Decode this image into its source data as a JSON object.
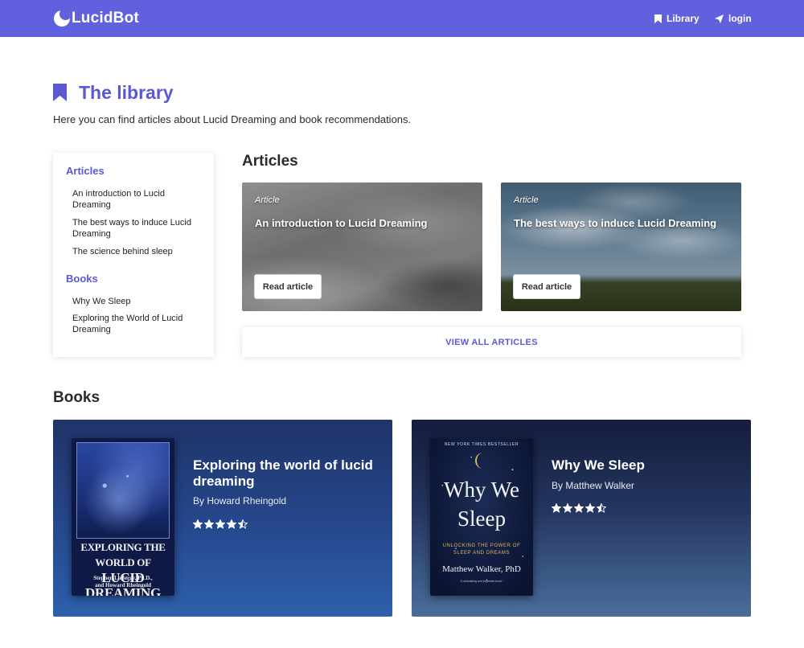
{
  "navbar": {
    "brand": "LucidBot",
    "library_label": "Library",
    "login_label": "login",
    "color": "#6160df"
  },
  "header": {
    "title": "The library",
    "description": "Here you can find articles about Lucid Dreaming and book recommendations."
  },
  "sidebar": {
    "articles_heading": "Articles",
    "articles": [
      "An introduction to Lucid Dreaming",
      "The best ways to induce Lucid Dreaming",
      "The science behind sleep"
    ],
    "books_heading": "Books",
    "books": [
      "Why We Sleep",
      "Exploring the World of Lucid Dreaming"
    ]
  },
  "articles": {
    "title": "Articles",
    "cards": [
      {
        "kicker": "Article",
        "title": "An introduction to Lucid Dreaming",
        "button": "Read article"
      },
      {
        "kicker": "Article",
        "title": "The best ways to induce Lucid Dreaming",
        "button": "Read article"
      }
    ],
    "view_all_label": "VIEW ALL ARTICLES"
  },
  "books": {
    "title": "Books",
    "cards": [
      {
        "title": "Exploring the world of lucid dreaming",
        "author": "By Howard Rheingold",
        "rating": 4.5,
        "cover": {
          "title_line1": "EXPLORING THE WORLD OF",
          "title_line2": "LUCID DREAMING",
          "authors_line1": "Stephen LaBerge, Ph.D.,",
          "authors_line2": "and Howard Rheingold"
        }
      },
      {
        "title": "Why We Sleep",
        "author": "By Matthew Walker",
        "rating": 4.5,
        "cover": {
          "top_line": "NEW YORK TIMES BESTSELLER",
          "title_line1": "Why We",
          "title_line2": "Sleep",
          "sub_line1": "UNLOCKING THE POWER OF",
          "sub_line2": "SLEEP AND DREAMS",
          "author": "Matthew Walker, PhD",
          "blurb": "\"A stimulating and important book.\""
        }
      }
    ]
  },
  "colors": {
    "accent": "#5b58d6",
    "star": "#ffffff"
  }
}
